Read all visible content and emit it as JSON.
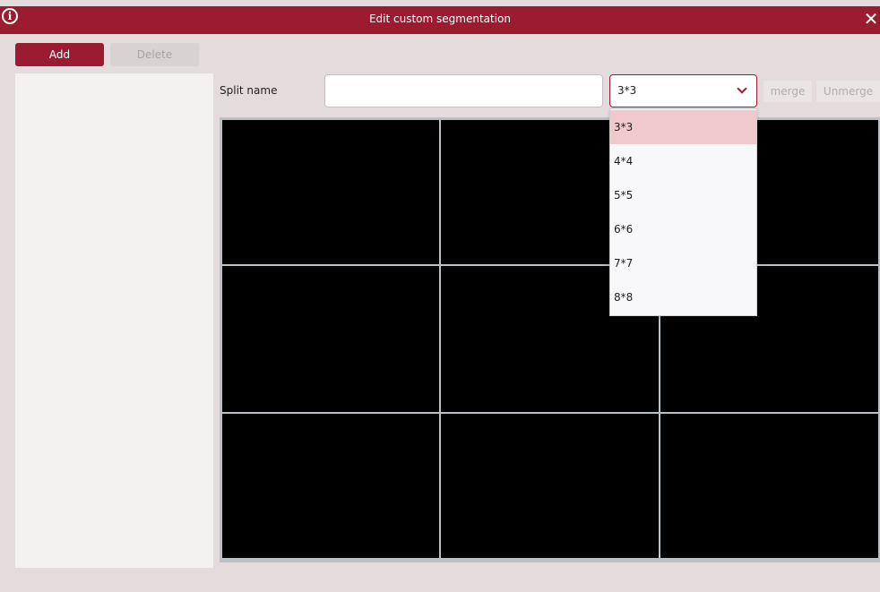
{
  "window": {
    "title": "Edit custom segmentation",
    "info_icon": "info-icon",
    "close_icon": "close-icon",
    "accent_color": "#9b1b30"
  },
  "toolbar": {
    "add_label": "Add",
    "delete_label": "Delete"
  },
  "form": {
    "split_name_label": "Split name",
    "split_name_value": "",
    "selected_layout": "3*3"
  },
  "actions": {
    "merge_label": "merge",
    "unmerge_label": "Unmerge"
  },
  "dropdown": {
    "options": [
      "3*3",
      "4*4",
      "5*5",
      "6*6",
      "7*7",
      "8*8"
    ],
    "highlighted": "3*3"
  },
  "grid": {
    "rows": 3,
    "cols": 3
  }
}
